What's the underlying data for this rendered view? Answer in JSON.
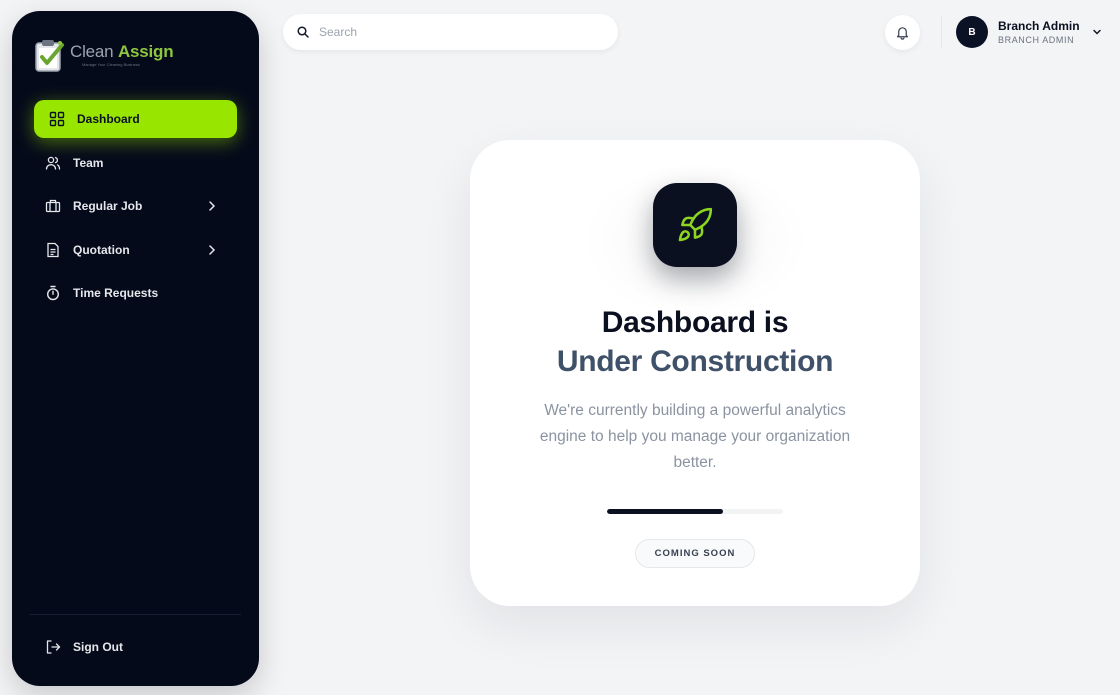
{
  "brand": {
    "name_part1": "Clean ",
    "name_part2": "Assign",
    "tagline": "Manage Your Cleaning Business"
  },
  "sidebar": {
    "items": [
      {
        "label": "Dashboard",
        "icon": "grid-icon",
        "active": true
      },
      {
        "label": "Team",
        "icon": "users-icon"
      },
      {
        "label": "Regular Job",
        "icon": "briefcase-icon",
        "has_submenu": true
      },
      {
        "label": "Quotation",
        "icon": "document-icon",
        "has_submenu": true
      },
      {
        "label": "Time Requests",
        "icon": "stopwatch-icon"
      }
    ],
    "signout_label": "Sign Out"
  },
  "header": {
    "search_placeholder": "Search",
    "user": {
      "initial": "B",
      "name": "Branch Admin",
      "role": "BRANCH ADMIN"
    }
  },
  "main": {
    "title_line1": "Dashboard is",
    "title_line2": "Under Construction",
    "description": "We're currently building a powerful analytics engine to help you manage your organization better.",
    "progress": 0.66,
    "badge": "COMING SOON"
  },
  "colors": {
    "accent": "#98e600",
    "sidebar_bg": "#050a1a",
    "dark": "#0b1020"
  }
}
